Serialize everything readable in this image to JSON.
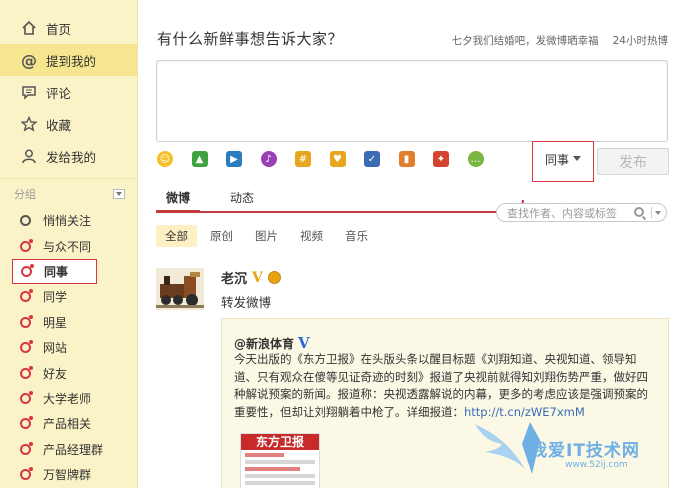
{
  "sidebar": {
    "nav": [
      {
        "label": "首页",
        "icon": "home-icon"
      },
      {
        "label": "提到我的",
        "icon": "at-icon"
      },
      {
        "label": "评论",
        "icon": "comment-icon"
      },
      {
        "label": "收藏",
        "icon": "star-icon"
      },
      {
        "label": "发给我的",
        "icon": "person-icon"
      }
    ],
    "group_header": "分组",
    "groups": [
      "悄悄关注",
      "与众不同",
      "同事",
      "同学",
      "明星",
      "网站",
      "好友",
      "大学老师",
      "产品相关",
      "产品经理群",
      "万智牌群"
    ]
  },
  "compose": {
    "title": "有什么新鲜事想告诉大家？",
    "topic": "七夕我们结婚吧，发微博晒幸福",
    "hot": "24小时热博",
    "scope": "同事",
    "publish": "发布"
  },
  "tabs": [
    "微博",
    "动态"
  ],
  "search": {
    "placeholder": "查找作者、内容或标签"
  },
  "filters": [
    "全部",
    "原创",
    "图片",
    "视频",
    "音乐"
  ],
  "post": {
    "author": "老沉",
    "verified": "V",
    "text": "转发微博",
    "repost": {
      "author": "@新浪体育",
      "verified": "V",
      "body": "今天出版的《东方卫报》在头版头条以醒目标题《刘翔知道、央视知道、领导知道、只有观众在傻等见证奇迹的时刻》报道了央视前就得知刘翔伤势严重，做好四种解说预案的新闻。报道称：央视透露解说的内幕，更多的考虑应该是强调预案的重要性，但却让刘翔躺着中枪了。详细报道：",
      "link": "http://t.cn/zWE7xmM",
      "image_title": "东方卫报"
    }
  },
  "watermark": {
    "text": "我爱IT技术网",
    "sub": "www.52ij.com"
  },
  "colors": {
    "sidebar_bg": "#fbf3c8",
    "accent_red": "#c23a3d",
    "link_blue": "#3b6cb4",
    "verified_gold": "#e8a40f"
  }
}
